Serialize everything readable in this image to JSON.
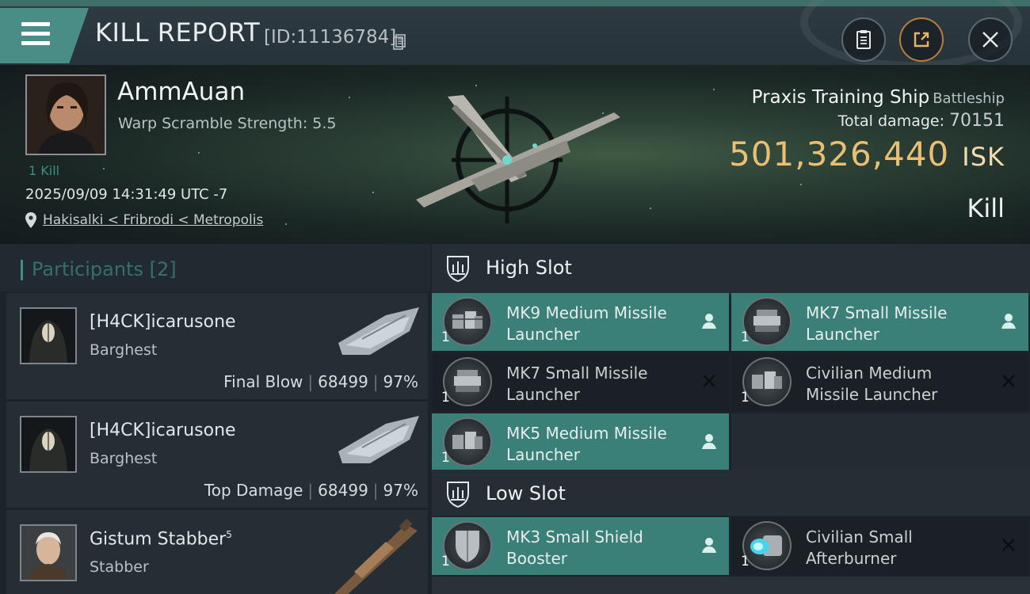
{
  "header": {
    "title": "KILL REPORT",
    "report_id": "[ID:11136784]",
    "buttons": [
      "clipboard-icon",
      "share-icon",
      "close-icon"
    ]
  },
  "victim": {
    "name": "AmmAuan",
    "warp_scramble": "Warp Scramble Strength: 5.5",
    "kill_count": "1 Kill",
    "datetime": "2025/09/09 14:31:49 UTC -7",
    "location": "Hakisalki < Fribrodi < Metropolis",
    "ship_name": "Praxis Training Ship",
    "ship_class": "Battleship",
    "total_damage_label": "Total damage:",
    "total_damage": "70151",
    "isk_value": "501,326,440",
    "isk_unit": "ISK",
    "result": "Kill"
  },
  "participants": {
    "label": "Participants",
    "count": "[2]",
    "rows": [
      {
        "name": "[H4CK]icarusone",
        "ship": "Barghest",
        "role": "Final Blow",
        "damage": "68499",
        "percent": "97%"
      },
      {
        "name": "[H4CK]icarusone",
        "ship": "Barghest",
        "role": "Top Damage",
        "damage": "68499",
        "percent": "97%"
      },
      {
        "name": "Gistum Stabber",
        "sup": "5",
        "ship": "Stabber"
      }
    ]
  },
  "high_slot": {
    "label": "High Slot",
    "modules": [
      {
        "name": "MK9 Medium Missile Launcher",
        "qty": "1",
        "status": "dropped"
      },
      {
        "name": "MK7 Small Missile Launcher",
        "qty": "1",
        "status": "dropped"
      },
      {
        "name": "MK7 Small Missile Launcher",
        "qty": "1",
        "status": "destroyed"
      },
      {
        "name": "Civilian Medium Missile Launcher",
        "qty": "1",
        "status": "destroyed"
      },
      {
        "name": "MK5 Medium Missile Launcher",
        "qty": "1",
        "status": "dropped"
      }
    ]
  },
  "low_slot": {
    "label": "Low Slot",
    "modules": [
      {
        "name": "MK3 Small Shield Booster",
        "qty": "1",
        "status": "dropped"
      },
      {
        "name": "Civilian Small Afterburner",
        "qty": "1",
        "status": "destroyed"
      }
    ]
  },
  "colors": {
    "accent": "#3a8078",
    "isk": "#e9c073",
    "background": "#1d232a"
  }
}
